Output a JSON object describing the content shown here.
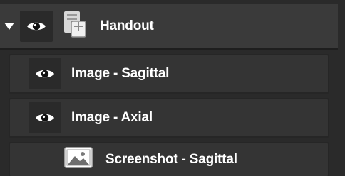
{
  "tree": {
    "parent": {
      "label": "Handout",
      "icon": "handout-document-icon",
      "expanded": true,
      "visible": true
    },
    "children": [
      {
        "label": "Image - Sagittal",
        "icon": "eye-icon",
        "visible": true
      },
      {
        "label": "Image - Axial",
        "icon": "eye-icon",
        "visible": true
      },
      {
        "label": "Screenshot - Sagittal",
        "icon": "image-icon",
        "visible": false
      }
    ]
  },
  "colors": {
    "panel_bg": "#2a2a2a",
    "row_bg": "#343434",
    "text": "#ffffff"
  }
}
